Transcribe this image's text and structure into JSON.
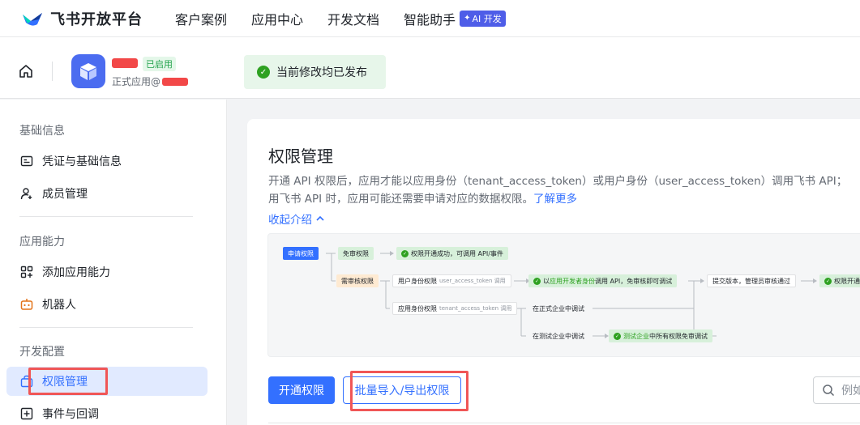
{
  "topnav": {
    "logo_text": "飞书开放平台",
    "items": [
      "客户案例",
      "应用中心",
      "开发文档",
      "智能助手"
    ],
    "ai_badge": "AI 开发"
  },
  "app_header": {
    "status_tag": "已启用",
    "subtitle": "正式应用@",
    "published_notice": "当前修改均已发布"
  },
  "sidebar": {
    "groups": [
      {
        "title": "基础信息",
        "items": [
          {
            "label": "凭证与基础信息",
            "icon": "credential-icon"
          },
          {
            "label": "成员管理",
            "icon": "member-icon"
          }
        ]
      },
      {
        "title": "应用能力",
        "items": [
          {
            "label": "添加应用能力",
            "icon": "add-capability-icon"
          },
          {
            "label": "机器人",
            "icon": "robot-icon"
          }
        ]
      },
      {
        "title": "开发配置",
        "items": [
          {
            "label": "权限管理",
            "icon": "permission-icon",
            "active": true
          },
          {
            "label": "事件与回调",
            "icon": "event-icon"
          }
        ]
      }
    ]
  },
  "main": {
    "title": "权限管理",
    "desc_line1": "开通 API 权限后，应用才能以应用身份（tenant_access_token）或用户身份（user_access_token）调用飞书 API；",
    "desc_line2": "用飞书 API 时，应用可能还需要申请对应的数据权限。",
    "learn_more": "了解更多",
    "collapse_label": "收起介绍",
    "flow": {
      "apply": "申请权限",
      "free": "免审权限",
      "free_result": "权限开通成功，可调用 API/事件",
      "review": "需审核权限",
      "user_identity": "用户身份权限",
      "user_token": "user_access_token 调用",
      "user_result_a": "以",
      "user_result_b": "应用开发者身份",
      "user_result_c": "调用 API，免审核即可调试",
      "submit": "提交版本，管理员审核通过",
      "final": "权限开通成",
      "app_identity": "应用身份权限",
      "tenant_token": "tenant_access_token 调用",
      "prod_debug": "在正式企业中调试",
      "test_debug": "在测试企业中调试",
      "test_result_a": "测试企业",
      "test_result_b": "中所有权限免审调试"
    },
    "enable_button": "开通权限",
    "batch_button": "批量导入/导出权限",
    "search_placeholder": "例如"
  },
  "colors": {
    "accent": "#3370ff",
    "success": "#2ea121",
    "highlight": "#f05656"
  }
}
